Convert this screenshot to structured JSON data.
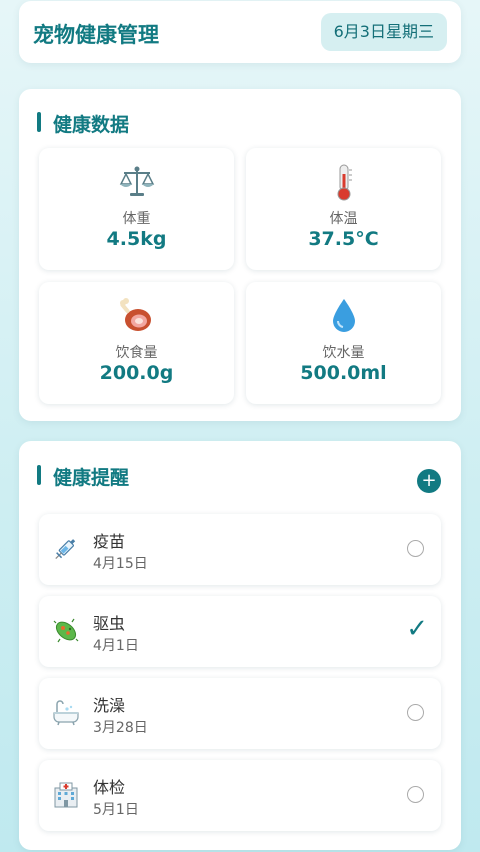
{
  "header": {
    "title": "宠物健康管理",
    "date": "6月3日星期三"
  },
  "health": {
    "section_title": "健康数据",
    "metrics": [
      {
        "label": "体重",
        "value": "4.5kg",
        "icon": "scale-icon"
      },
      {
        "label": "体温",
        "value": "37.5°C",
        "icon": "thermometer-icon"
      },
      {
        "label": "饮食量",
        "value": "200.0g",
        "icon": "meat-icon"
      },
      {
        "label": "饮水量",
        "value": "500.0ml",
        "icon": "water-drop-icon"
      }
    ]
  },
  "reminders": {
    "section_title": "健康提醒",
    "add_label": "+",
    "items": [
      {
        "title": "疫苗",
        "date": "4月15日",
        "done": false,
        "icon": "syringe-icon"
      },
      {
        "title": "驱虫",
        "date": "4月1日",
        "done": true,
        "icon": "microbe-icon"
      },
      {
        "title": "洗澡",
        "date": "3月28日",
        "done": false,
        "icon": "bathtub-icon"
      },
      {
        "title": "体检",
        "date": "5月1日",
        "done": false,
        "icon": "hospital-icon"
      }
    ],
    "check_mark": "✓"
  },
  "colors": {
    "accent": "#127a82",
    "date_badge_bg": "#d6eff1"
  }
}
